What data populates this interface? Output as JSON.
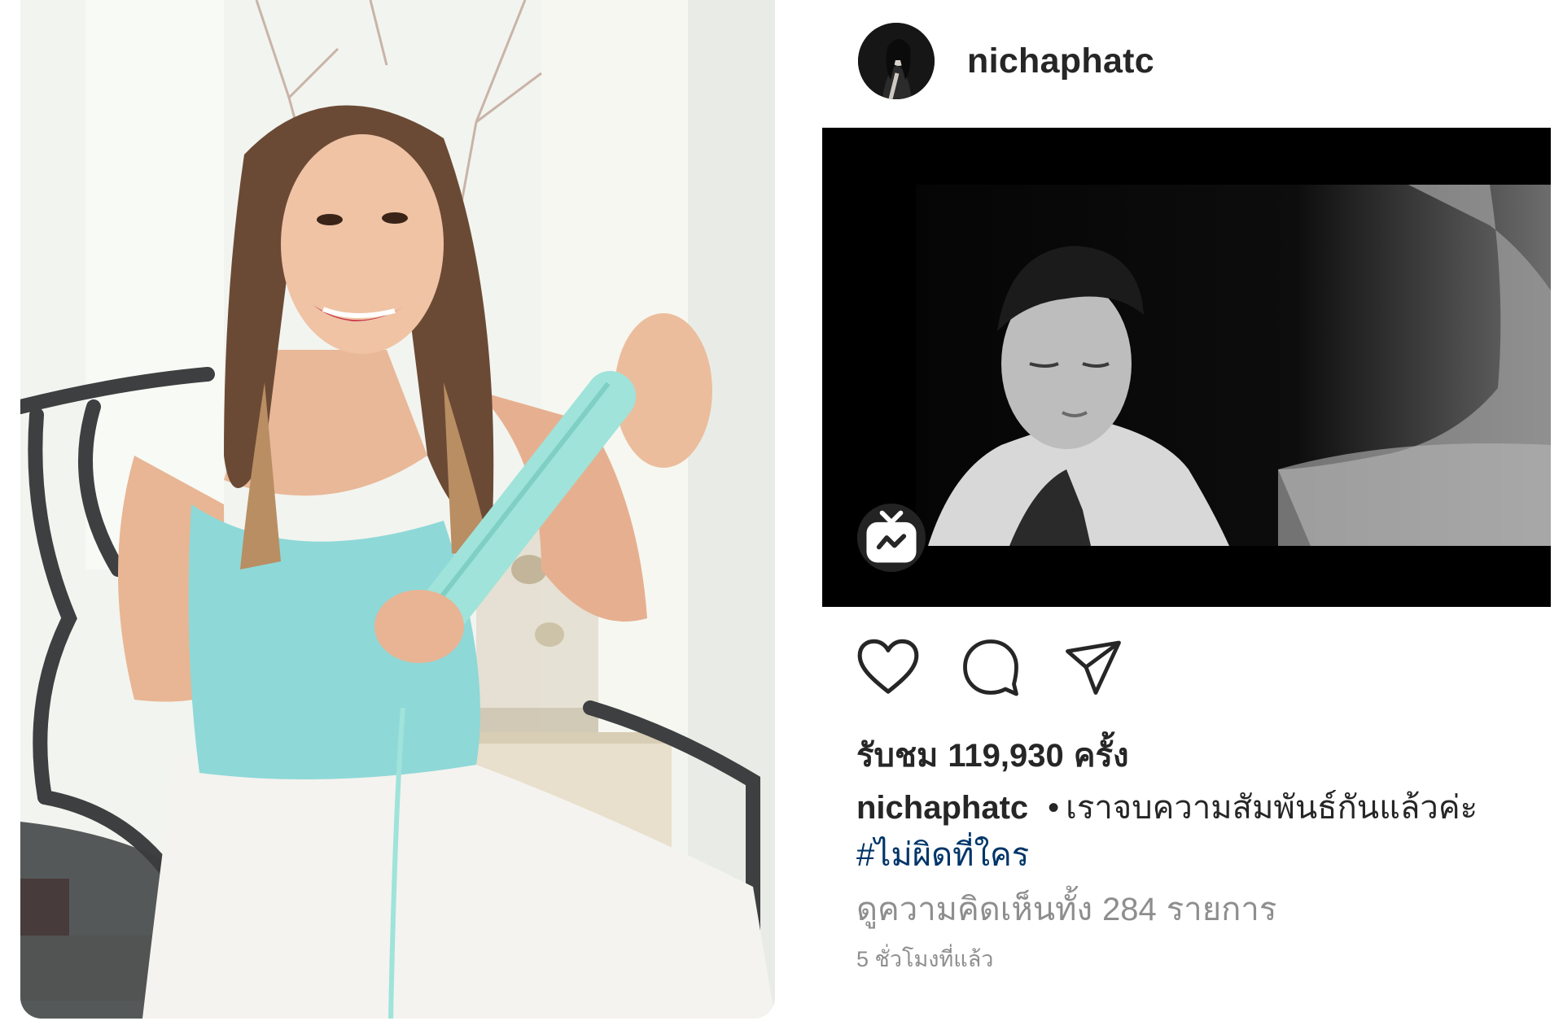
{
  "post": {
    "username": "nichaphatc",
    "views": {
      "prefix": "รับชม",
      "count": "119,930",
      "suffix": "ครั้ง"
    },
    "caption": {
      "username": "nichaphatc",
      "separator": "•",
      "text": "เราจบความสัมพันธ์กันแล้วค่ะ",
      "hashtag": "#ไม่ผิดที่ใคร"
    },
    "comments": {
      "prefix": "ดูความคิดเห็นทั้ง",
      "count": "284",
      "suffix": "รายการ"
    },
    "timestamp": "5 ชั่วโมงที่แล้ว"
  },
  "icons": {
    "like": "heart-icon",
    "comment": "comment-icon",
    "share": "paper-plane-icon",
    "igtv": "igtv-icon"
  },
  "colors": {
    "text": "#262626",
    "hashtag": "#003569",
    "muted": "#8e8e8e"
  }
}
